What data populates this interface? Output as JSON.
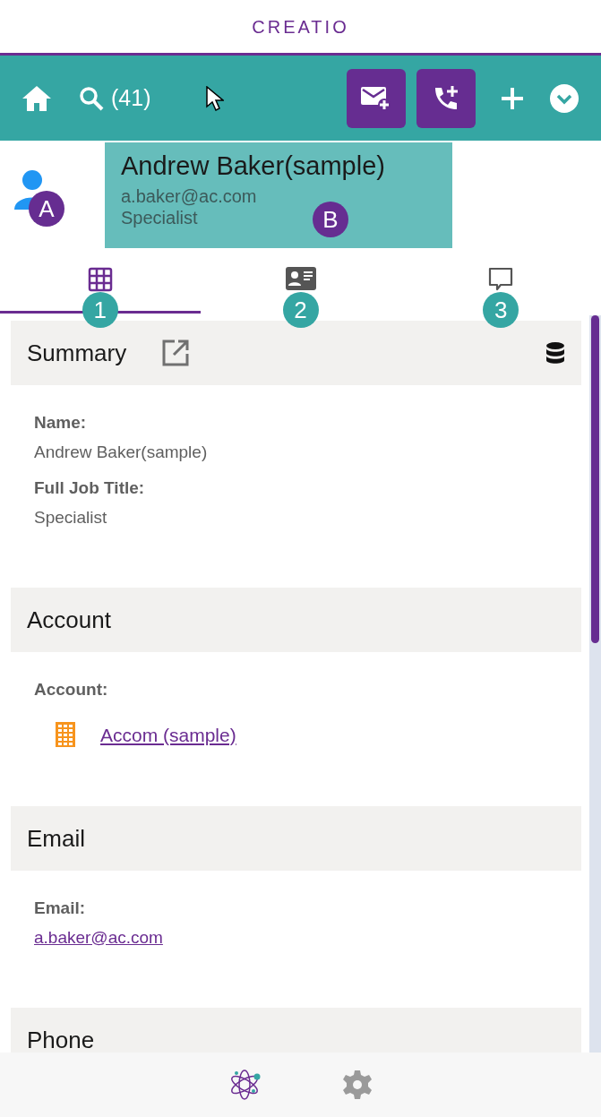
{
  "app_title": "CREATIO",
  "toolbar": {
    "search_count": "(41)"
  },
  "profile": {
    "avatar_callout": "A",
    "name": "Andrew Baker(sample)",
    "email": "a.baker@ac.com",
    "job_title": "Specialist",
    "callout": "B"
  },
  "tabs": [
    {
      "kind": "grid",
      "selected": true,
      "callout": "1"
    },
    {
      "kind": "card",
      "selected": false,
      "callout": "2"
    },
    {
      "kind": "chat",
      "selected": false,
      "callout": "3"
    }
  ],
  "sections": [
    {
      "title": "Summary",
      "tools": true,
      "fields": [
        {
          "label": "Name:",
          "value": "Andrew Baker(sample)",
          "kind": "text"
        },
        {
          "label": "Full Job Title:",
          "value": "Specialist",
          "kind": "text"
        }
      ]
    },
    {
      "title": "Account",
      "tools": false,
      "fields": [
        {
          "label": "Account:",
          "value": "Accom (sample)",
          "kind": "account"
        }
      ]
    },
    {
      "title": "Email",
      "tools": false,
      "fields": [
        {
          "label": "Email:",
          "value": "a.baker@ac.com",
          "kind": "link"
        }
      ]
    },
    {
      "title": "Phone",
      "tools": false
    }
  ]
}
